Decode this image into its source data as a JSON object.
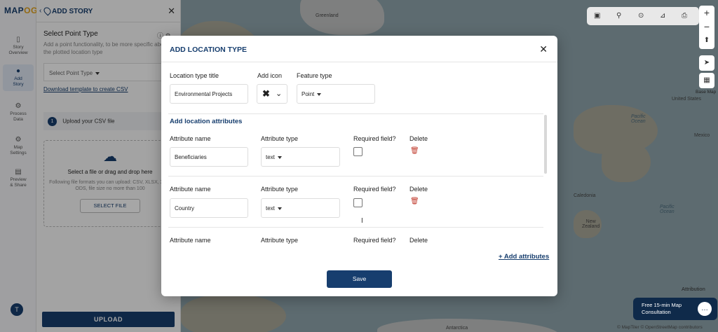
{
  "app": {
    "logo_main": "MAP",
    "logo_accent": "OG"
  },
  "nav": {
    "items": [
      {
        "label": "Story\nOverview"
      },
      {
        "label": "Add\nStory"
      },
      {
        "label": "Process\nData"
      },
      {
        "label": "Map\nSettings"
      },
      {
        "label": "Preview\n& Share"
      }
    ],
    "avatar_letter": "T"
  },
  "panel": {
    "title": "ADD STORY",
    "section_title": "Select Point Type",
    "description": "Add a point functionality, to be more specific about the plotted location type",
    "select_placeholder": "Select Point Type",
    "download_link": "Download template to create CSV",
    "step_number": "1",
    "step_label": "Upload your CSV file",
    "dropzone_title": "Select a file or drag and drop here",
    "dropzone_sub": "Following file formats you can upload: CSV, XLSX, XLS, ODS, file size no more than 100",
    "select_file_button": "SELECT FILE",
    "upload_button": "UPLOAD"
  },
  "map": {
    "labels": {
      "greenland": "Greenland",
      "pacific_north": "Pacific\nOcean",
      "mexico": "Mexico",
      "pacific_south": "Pacific\nOcean",
      "united_states": "United States",
      "caledonia": "Caledonia",
      "new_zealand": "New\nZealand",
      "antarctica": "Antarctica"
    },
    "basemap_label": "Base Map",
    "attribution": "Attribution",
    "consult_text": "Free 15-min Map Consultation",
    "copyright": "© MapTiler © OpenStreetMap contributors"
  },
  "modal": {
    "title": "ADD LOCATION TYPE",
    "location_type_title_label": "Location type title",
    "location_type_title_value": "Environmental Projects",
    "add_icon_label": "Add icon",
    "feature_type_label": "Feature type",
    "feature_type_value": "Point",
    "attributes_section_title": "Add location attributes",
    "column_headers": {
      "name": "Attribute name",
      "type": "Attribute type",
      "required": "Required field?",
      "delete": "Delete"
    },
    "attributes": [
      {
        "name": "Beneficiaries",
        "type": "text",
        "required": false
      },
      {
        "name": "Country",
        "type": "text",
        "required": false
      }
    ],
    "add_attributes_link": "+ Add attributes",
    "save_button": "Save"
  },
  "colors": {
    "primary": "#173e6e",
    "accent": "#e2a11b",
    "danger": "#c0392b"
  }
}
